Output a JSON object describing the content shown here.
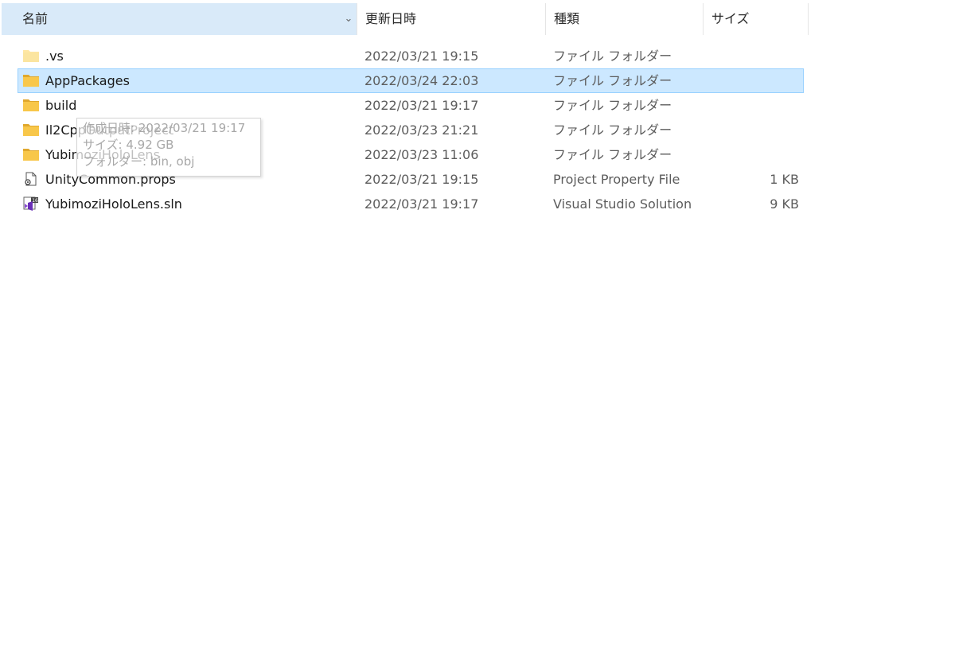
{
  "header": {
    "name_label": "名前",
    "date_label": "更新日時",
    "type_label": "種類",
    "size_label": "サイズ",
    "sort_indicator": "^",
    "dropdown_indicator": "⌄"
  },
  "rows": [
    {
      "icon": "folder-icon",
      "name": ".vs",
      "date": "2022/03/21 19:15",
      "type": "ファイル フォルダー",
      "size": "",
      "selected": false
    },
    {
      "icon": "folder-icon",
      "name": "AppPackages",
      "date": "2022/03/24 22:03",
      "type": "ファイル フォルダー",
      "size": "",
      "selected": true
    },
    {
      "icon": "folder-icon",
      "name": "build",
      "date": "2022/03/21 19:17",
      "type": "ファイル フォルダー",
      "size": "",
      "selected": false
    },
    {
      "icon": "folder-icon",
      "name": "Il2CppOutputProject",
      "date": "2022/03/23 21:21",
      "type": "ファイル フォルダー",
      "size": "",
      "selected": false
    },
    {
      "icon": "folder-icon",
      "name": "YubimoziHoloLens",
      "date": "2022/03/23 11:06",
      "type": "ファイル フォルダー",
      "size": "",
      "selected": false
    },
    {
      "icon": "props-file-icon",
      "name": "UnityCommon.props",
      "date": "2022/03/21 19:15",
      "type": "Project Property File",
      "size": "1 KB",
      "selected": false
    },
    {
      "icon": "visual-studio-solution-icon",
      "name": "YubimoziHoloLens.sln",
      "date": "2022/03/21 19:17",
      "type": "Visual Studio Solution",
      "size": "9 KB",
      "selected": false
    }
  ],
  "tooltip": {
    "created": "作成日時: 2022/03/21 19:17",
    "size": "サイズ: 4.92 GB",
    "folders": "フォルダー: bin, obj"
  },
  "colors": {
    "selection_bg": "#cce8ff",
    "selection_border": "#99d1ff",
    "header_active_bg": "#d9eaf9",
    "folder_yellow": "#f8c74a"
  }
}
